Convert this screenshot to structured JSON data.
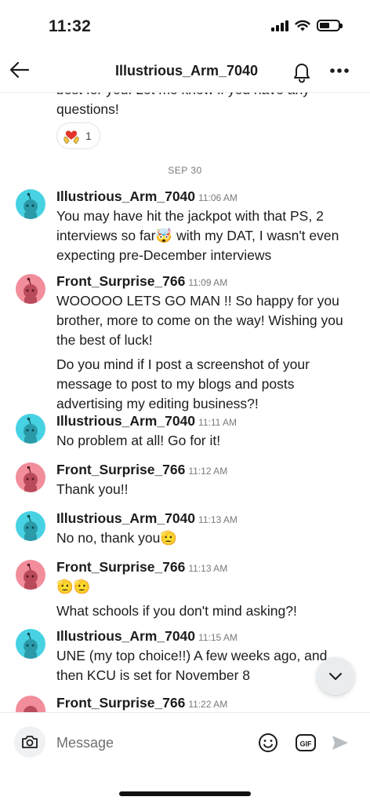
{
  "status_bar": {
    "time": "11:32"
  },
  "header": {
    "title": "Illustrious_Arm_7040"
  },
  "previous_message": {
    "partial_text": "best for you. Let me know if you have any questions!",
    "reaction_count": "1"
  },
  "date_separator": "SEP 30",
  "messages": [
    {
      "author": "Illustrious_Arm_7040",
      "time": "11:06 AM",
      "avatar": "cyan",
      "paragraphs": [
        "You may have hit the jackpot with that PS, 2 interviews so far🤯 with my DAT, I wasn't even expecting pre-December interviews"
      ]
    },
    {
      "author": "Front_Surprise_766",
      "time": "11:09 AM",
      "avatar": "pink",
      "paragraphs": [
        "WOOOOO LETS GO MAN !! So happy for you brother, more to come on the way! Wishing you the best of luck!",
        "Do you mind if I post a screenshot of your message to post to my blogs and posts advertising my editing business?!"
      ]
    },
    {
      "author": "Illustrious_Arm_7040",
      "time": "11:11 AM",
      "avatar": "cyan",
      "paragraphs": [
        "No problem at all! Go for it!"
      ]
    },
    {
      "author": "Front_Surprise_766",
      "time": "11:12 AM",
      "avatar": "pink",
      "paragraphs": [
        "Thank you!!"
      ]
    },
    {
      "author": "Illustrious_Arm_7040",
      "time": "11:13 AM",
      "avatar": "cyan",
      "paragraphs": [
        "No no, thank you🫡"
      ]
    },
    {
      "author": "Front_Surprise_766",
      "time": "11:13 AM",
      "avatar": "pink",
      "paragraphs": [
        "🫡🫡",
        "What schools if you don't mind asking?!"
      ]
    },
    {
      "author": "Illustrious_Arm_7040",
      "time": "11:15 AM",
      "avatar": "cyan",
      "paragraphs": [
        "UNE (my top choice!!) A few weeks ago, and then KCU is set for November 8"
      ]
    },
    {
      "author": "Front_Surprise_766",
      "time": "11:22 AM",
      "avatar": "pink",
      "paragraphs": []
    }
  ],
  "composer": {
    "placeholder": "Message",
    "gif_label": "GIF"
  },
  "icons": {
    "back": "arrow-left-icon",
    "bell": "bell-icon",
    "more": "more-dots-icon",
    "camera": "camera-icon",
    "emoji": "smiley-icon",
    "gif": "gif-icon",
    "send": "send-arrow-icon",
    "scroll_down": "chevron-down-icon",
    "reaction": "heart-hands-icon",
    "avatar": "snoo-avatar-icon"
  },
  "colors": {
    "avatar_cyan": "#47d2e3",
    "avatar_pink": "#f28d9c"
  }
}
